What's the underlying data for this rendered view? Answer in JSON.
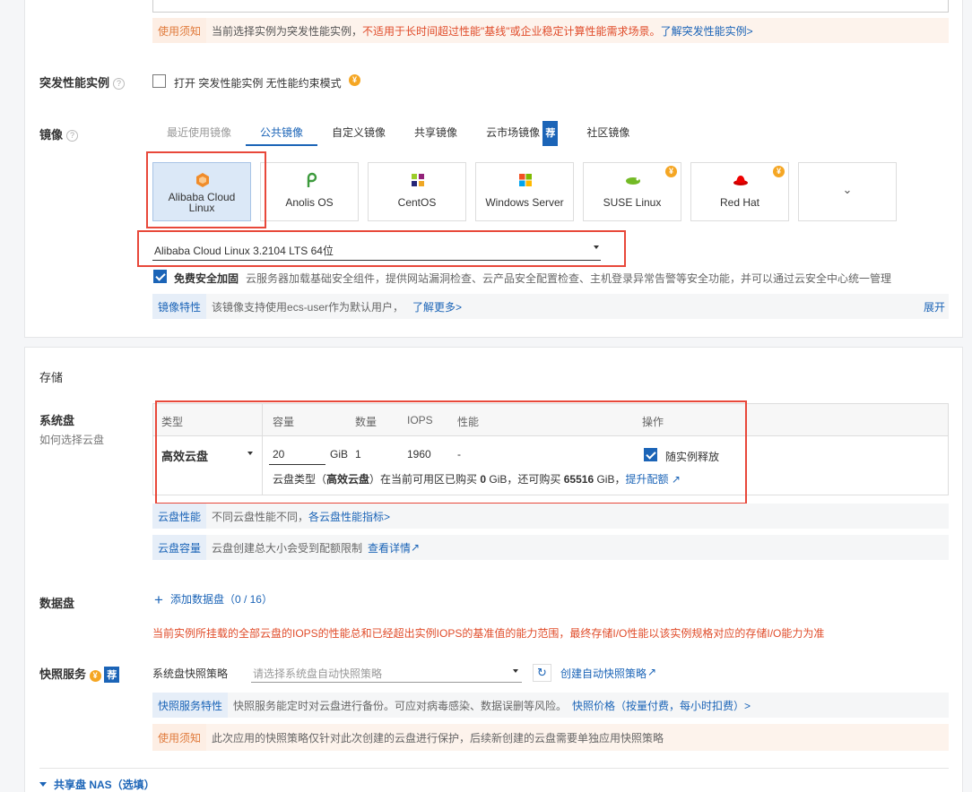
{
  "top_notice": {
    "tag": "使用须知",
    "text": "当前选择实例为突发性能实例，",
    "red": "不适用于长时间超过性能\"基线\"或企业稳定计算性能需求场景。",
    "link": "了解突发性能实例>"
  },
  "burst": {
    "label": "突发性能实例",
    "help": "?",
    "checkbox_text": "打开 突发性能实例 无性能约束模式",
    "coin": "¥"
  },
  "image": {
    "label": "镜像",
    "help": "?",
    "tabs": [
      "最近使用镜像",
      "公共镜像",
      "自定义镜像",
      "共享镜像",
      "云市场镜像",
      "社区镜像"
    ],
    "market_badge": "荐",
    "tiles": [
      {
        "name_line1": "Alibaba Cloud",
        "name_line2": "Linux",
        "icon": "alibaba-cloud-linux-icon"
      },
      {
        "name_line1": "Anolis OS",
        "icon": "anolis-icon"
      },
      {
        "name_line1": "CentOS",
        "icon": "centos-icon"
      },
      {
        "name_line1": "Windows Server",
        "icon": "windows-icon"
      },
      {
        "name_line1": "SUSE Linux",
        "icon": "suse-icon",
        "coin": "¥"
      },
      {
        "name_line1": "Red Hat",
        "icon": "redhat-icon",
        "coin": "¥"
      }
    ],
    "more_icon": "⌄",
    "version": "Alibaba Cloud Linux 3.2104 LTS 64位",
    "security_label": "免费安全加固",
    "security_desc": "云服务器加载基础安全组件，提供网站漏洞检查、云产品安全配置检查、主机登录异常告警等安全功能，并可以通过云安全中心统一管理",
    "feature_tag": "镜像特性",
    "feature_text": "该镜像支持使用ecs-user作为默认用户，",
    "feature_link": "了解更多>",
    "expand": "展开"
  },
  "storage": {
    "title": "存储",
    "system_disk_label": "系统盘",
    "system_disk_help": "如何选择云盘",
    "headers": {
      "type": "类型",
      "capacity": "容量",
      "count": "数量",
      "iops": "IOPS",
      "perf": "性能",
      "ops": "操作"
    },
    "row": {
      "type": "高效云盘",
      "capacity": "20",
      "unit": "GiB",
      "count": "1",
      "iops": "1960",
      "perf": "-",
      "release_label": "随实例释放"
    },
    "info": {
      "prefix": "云盘类型（",
      "type": "高效云盘",
      "mid": "）在当前可用区已购买 ",
      "bought": "0",
      "mid2": " GiB，还可购买 ",
      "remain": "65516",
      "suffix": " GiB，",
      "link": "提升配额"
    },
    "perf_tag": "云盘性能",
    "perf_text": "不同云盘性能不同，",
    "perf_link": "各云盘性能指标>",
    "cap_tag": "云盘容量",
    "cap_text": "云盘创建总大小会受到配额限制",
    "cap_link": "查看详情",
    "data_disk_label": "数据盘",
    "add_data_disk": "添加数据盘",
    "add_count": "（0 / 16）",
    "iops_warning": "当前实例所挂载的全部云盘的IOPS的性能总和已经超出实例IOPS的基准值的能力范围，最终存储I/O性能以该实例规格对应的存储I/O能力为准"
  },
  "snapshot": {
    "label": "快照服务",
    "coin": "¥",
    "badge": "荐",
    "policy_label": "系统盘快照策略",
    "policy_placeholder": "请选择系统盘自动快照策略",
    "create_link": "创建自动快照策略",
    "feature_tag": "快照服务特性",
    "feature_text": "快照服务能定时对云盘进行备份。可应对病毒感染、数据误删等风险。",
    "price_link": "快照价格（按量付费，每小时扣费）>",
    "notice_tag": "使用须知",
    "notice_text": "此次应用的快照策略仅针对此次创建的云盘进行保护，后续新创建的云盘需要单独应用快照策略"
  },
  "nas": {
    "label": "共享盘 NAS（选填）"
  }
}
